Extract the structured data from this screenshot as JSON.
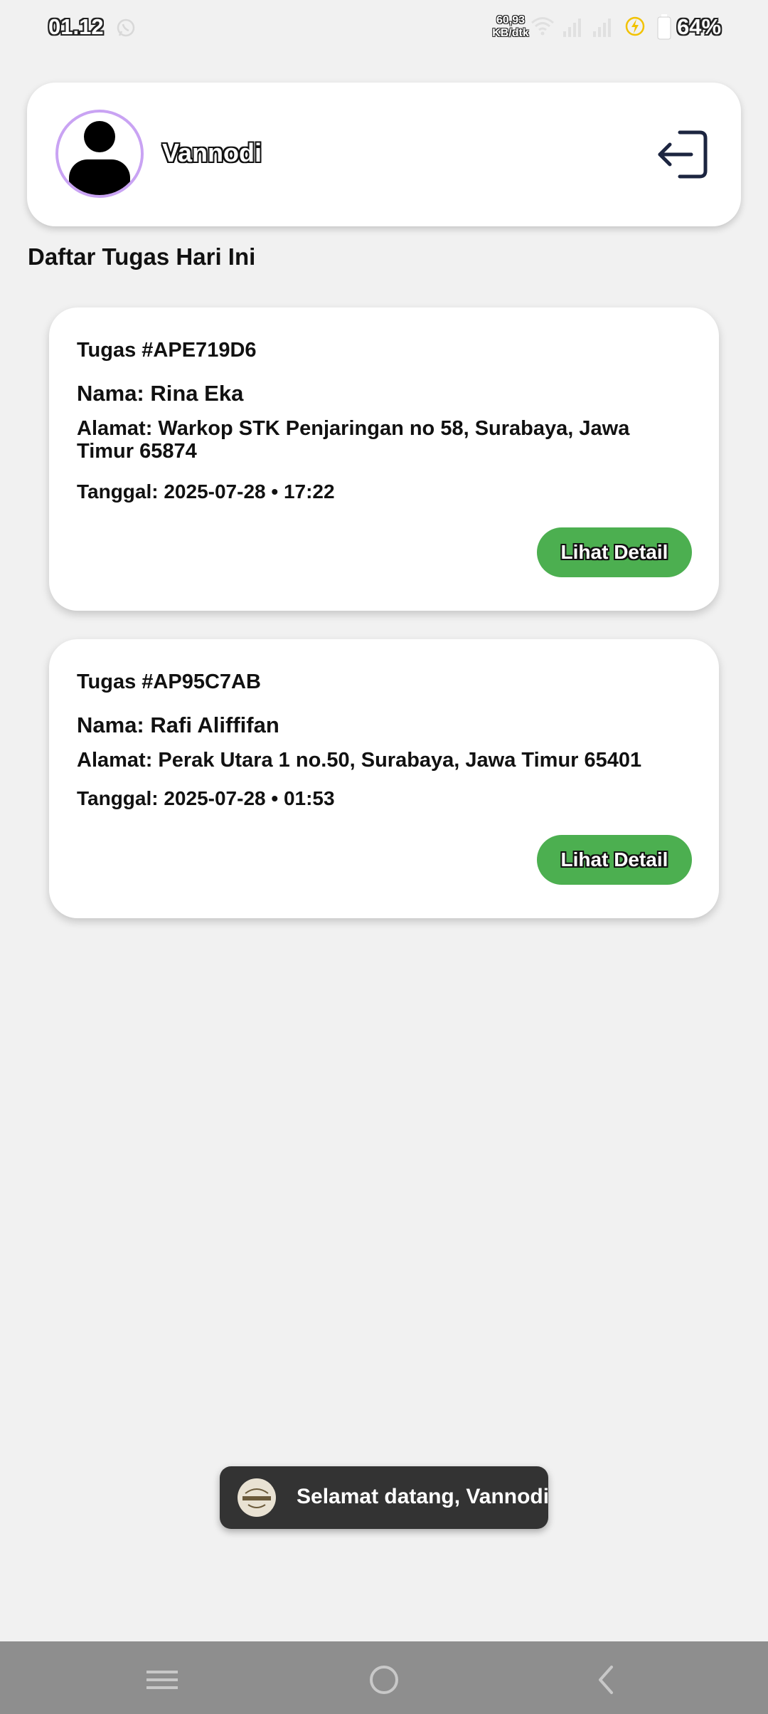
{
  "status_bar": {
    "time": "01.12",
    "net_speed_value": "60,93",
    "net_speed_unit": "KB/dtk",
    "battery": "64%",
    "icons": [
      "whatsapp-icon",
      "wifi-icon",
      "signal-icon",
      "signal-icon",
      "charging-icon",
      "battery-icon"
    ]
  },
  "profile": {
    "name": "Vannodi",
    "avatar_icon": "person-icon",
    "avatar_ring_color": "#c9a3f3",
    "logout_icon": "logout-icon"
  },
  "section_title": "Daftar Tugas Hari Ini",
  "tasks": [
    {
      "id": "Tugas #APE719D6",
      "name": "Nama: Rina Eka",
      "address": "Alamat: Warkop STK Penjaringan no 58, Surabaya, Jawa Timur 65874",
      "date": "Tanggal: 2025-07-28 • 17:22",
      "button_label": "Lihat Detail"
    },
    {
      "id": "Tugas #AP95C7AB",
      "name": "Nama: Rafi Aliffifan",
      "address": "Alamat: Perak Utara 1 no.50, Surabaya, Jawa Timur 65401",
      "date": "Tanggal: 2025-07-28 • 01:53",
      "button_label": "Lihat Detail"
    }
  ],
  "toast": {
    "message": "Selamat datang, Vannodi",
    "logo_icon": "khumas-logo"
  },
  "nav": {
    "icons": [
      "menu-icon",
      "home-icon",
      "back-icon"
    ]
  },
  "colors": {
    "background": "#f1f1f1",
    "button": "#4caf50",
    "toast_bg": "#333333",
    "nav_bg": "#8e8e8e"
  }
}
